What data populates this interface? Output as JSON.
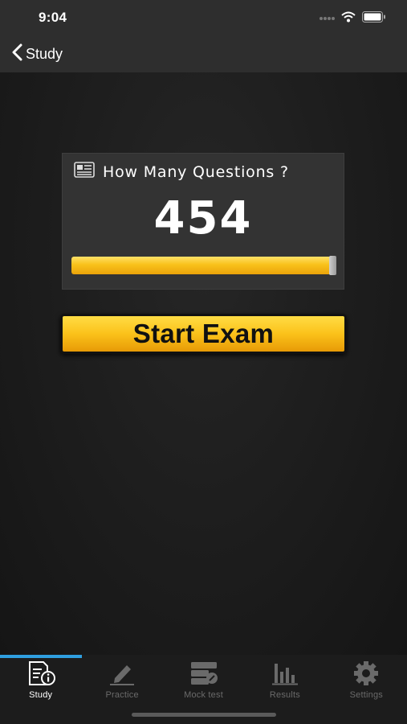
{
  "status_bar": {
    "time": "9:04"
  },
  "nav": {
    "back_label": "Study"
  },
  "card": {
    "icon": "newspaper-icon",
    "title": "How Many Questions ?",
    "count": "454",
    "slider_fraction": 1.0
  },
  "start_button": {
    "label": "Start Exam"
  },
  "tab_bar": {
    "tabs": [
      {
        "label": "Study",
        "icon": "study-info-icon",
        "active": true
      },
      {
        "label": "Practice",
        "icon": "pencil-icon",
        "active": false
      },
      {
        "label": "Mock test",
        "icon": "mock-test-icon",
        "active": false
      },
      {
        "label": "Results",
        "icon": "bar-chart-icon",
        "active": false
      },
      {
        "label": "Settings",
        "icon": "gear-icon",
        "active": false
      }
    ]
  },
  "colors": {
    "accent_yellow": "#f9c21b",
    "tab_indicator": "#2f9fe0",
    "background": "#1b1b1b"
  }
}
